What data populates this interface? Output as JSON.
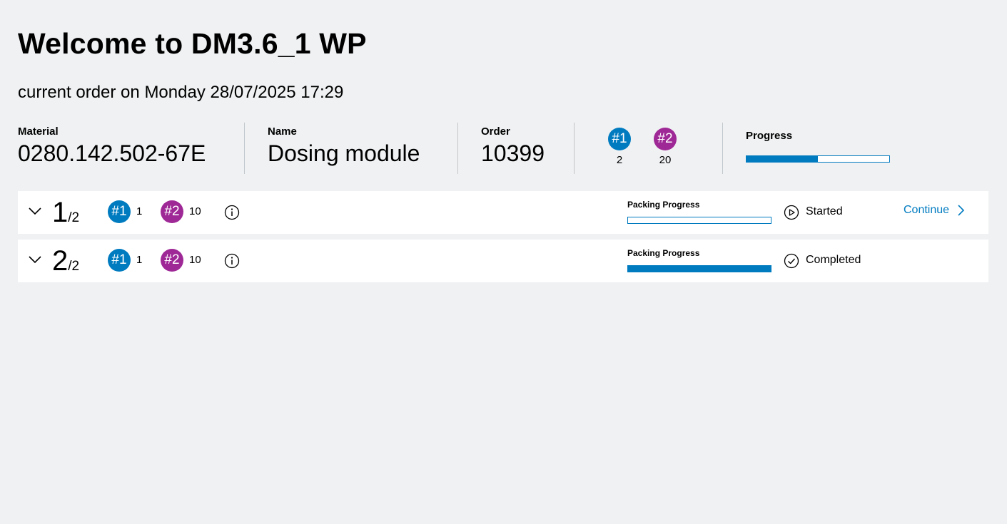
{
  "header": {
    "title": "Welcome to DM3.6_1 WP",
    "subtitle_prefix": "current order on",
    "day": "Monday",
    "date": "28/07/2025",
    "time": "17:29"
  },
  "summary": {
    "material_label": "Material",
    "material_value": "0280.142.502-67E",
    "name_label": "Name",
    "name_value": "Dosing module",
    "order_label": "Order",
    "order_value": "10399",
    "badge1_label": "#1",
    "badge1_count": "2",
    "badge2_label": "#2",
    "badge2_count": "20",
    "progress_label": "Progress",
    "progress_fraction": 0.5
  },
  "colors": {
    "accent_blue": "#007bc0",
    "accent_purple": "#9e2896",
    "background": "#eff1f2"
  },
  "rows": [
    {
      "index": "1",
      "total": "/2",
      "badge1_label": "#1",
      "badge1_count": "1",
      "badge2_label": "#2",
      "badge2_count": "10",
      "packing_label": "Packing Progress",
      "packing_fraction": 0.0,
      "status_icon": "play-circle-icon",
      "status": "Started",
      "action": "Continue"
    },
    {
      "index": "2",
      "total": "/2",
      "badge1_label": "#1",
      "badge1_count": "1",
      "badge2_label": "#2",
      "badge2_count": "10",
      "packing_label": "Packing Progress",
      "packing_fraction": 1.0,
      "status_icon": "check-circle-icon",
      "status": "Completed"
    }
  ]
}
